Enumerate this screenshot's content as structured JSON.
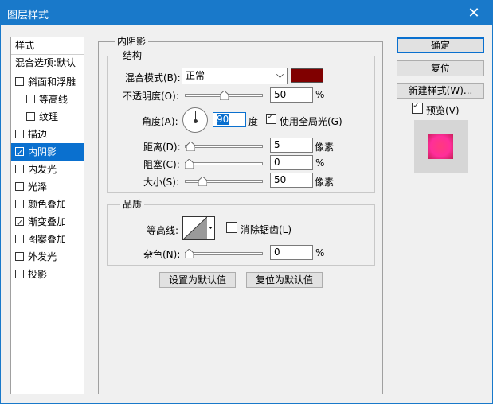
{
  "window": {
    "title": "图层样式",
    "close_glyph": "✕"
  },
  "sidebar": {
    "header_styles": "样式",
    "header_blending": "混合选项:默认",
    "items": [
      {
        "label": "斜面和浮雕",
        "checked": false,
        "selected": false,
        "indent": false
      },
      {
        "label": "等高线",
        "checked": false,
        "selected": false,
        "indent": true
      },
      {
        "label": "纹理",
        "checked": false,
        "selected": false,
        "indent": true
      },
      {
        "label": "描边",
        "checked": false,
        "selected": false,
        "indent": false
      },
      {
        "label": "内阴影",
        "checked": true,
        "selected": true,
        "indent": false
      },
      {
        "label": "内发光",
        "checked": false,
        "selected": false,
        "indent": false
      },
      {
        "label": "光泽",
        "checked": false,
        "selected": false,
        "indent": false
      },
      {
        "label": "颜色叠加",
        "checked": false,
        "selected": false,
        "indent": false
      },
      {
        "label": "渐变叠加",
        "checked": true,
        "selected": false,
        "indent": false
      },
      {
        "label": "图案叠加",
        "checked": false,
        "selected": false,
        "indent": false
      },
      {
        "label": "外发光",
        "checked": false,
        "selected": false,
        "indent": false
      },
      {
        "label": "投影",
        "checked": false,
        "selected": false,
        "indent": false
      }
    ]
  },
  "main": {
    "section_title": "内阴影",
    "structure": {
      "title": "结构",
      "blend_mode_label": "混合模式(B):",
      "blend_mode_value": "正常",
      "shadow_color": "#800000",
      "opacity_label": "不透明度(O):",
      "opacity_value": "50",
      "opacity_fraction": 0.5,
      "opacity_unit": "%",
      "angle_label": "角度(A):",
      "angle_value": "90",
      "angle_unit": "度",
      "global_light_label": "使用全局光(G)",
      "global_light_checked": true,
      "distance_label": "距离(D):",
      "distance_value": "5",
      "distance_fraction": 0.02,
      "distance_unit": "像素",
      "choke_label": "阻塞(C):",
      "choke_value": "0",
      "choke_fraction": 0.0,
      "choke_unit": "%",
      "size_label": "大小(S):",
      "size_value": "50",
      "size_fraction": 0.2,
      "size_unit": "像素"
    },
    "quality": {
      "title": "品质",
      "contour_label": "等高线:",
      "anti_alias_label": "消除锯齿(L)",
      "anti_alias_checked": false,
      "noise_label": "杂色(N):",
      "noise_value": "0",
      "noise_fraction": 0.0,
      "noise_unit": "%"
    },
    "make_default": "设置为默认值",
    "reset_default": "复位为默认值"
  },
  "actions": {
    "ok": "确定",
    "reset": "复位",
    "new_style": "新建样式(W)...",
    "preview_label": "预览(V)",
    "preview_checked": true
  }
}
